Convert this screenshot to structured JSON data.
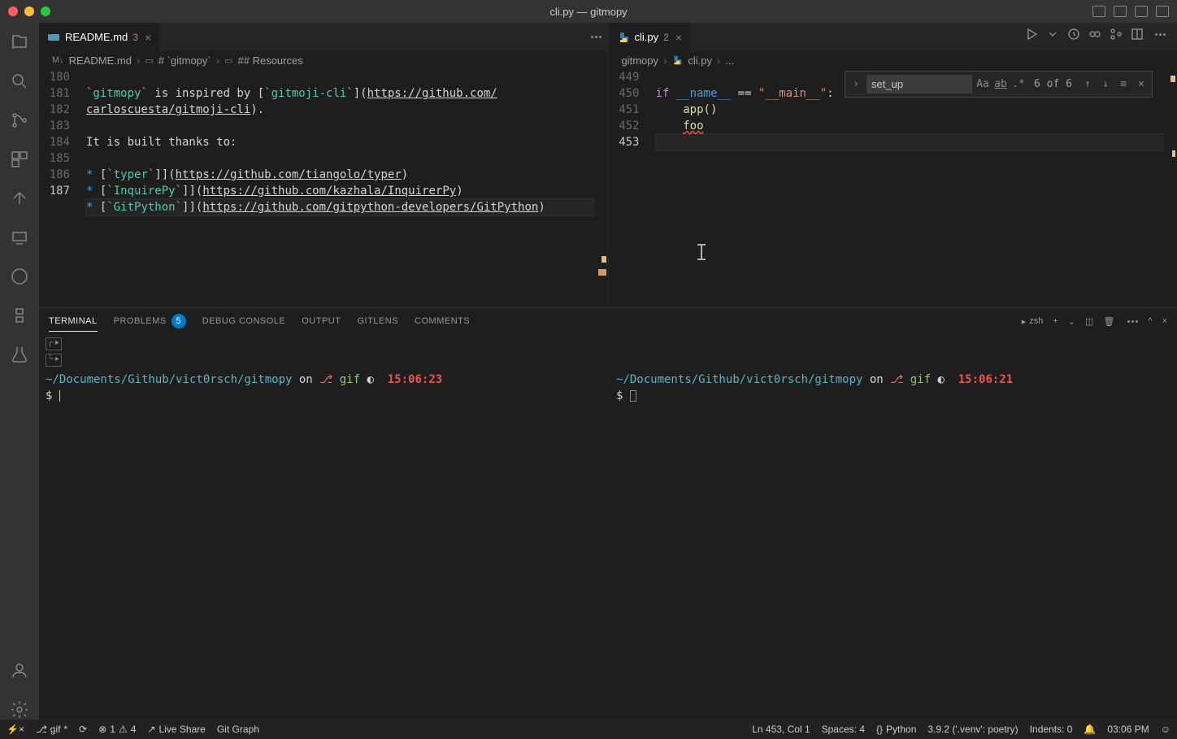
{
  "titlebar": {
    "title": "cli.py — gitmopy"
  },
  "tabs_left": {
    "name": "README.md",
    "badge": "3"
  },
  "tabs_right": {
    "name": "cli.py",
    "badge": "2"
  },
  "breadcrumb_left": [
    "README.md",
    "# `gitmopy`",
    "## Resources"
  ],
  "breadcrumb_right": [
    "gitmopy",
    "cli.py",
    "..."
  ],
  "find": {
    "value": "set_up",
    "count": "6 of 6"
  },
  "left_gutter": [
    "180",
    "181",
    "",
    "182",
    "183",
    "184",
    "185",
    "186",
    "187"
  ],
  "left_code": {
    "l181a": "`gitmopy`",
    "l181b": " is inspired by [",
    "l181c": "`gitmoji-cli`",
    "l181d": "](",
    "l181e": "https://github.com/",
    "l181f": "carloscuesta/gitmoji-cli",
    "l181g": ").",
    "l183": "It is built thanks to:",
    "l185a": "* [",
    "l185b": "`typer`",
    "l185c": "](",
    "l185d": "https://github.com/tiangolo/typer",
    "l185e": ")",
    "l186a": "* [",
    "l186b": "`InquirePy`",
    "l186c": "](",
    "l186d": "https://github.com/kazhala/InquirerPy",
    "l186e": ")",
    "l187a": "* [",
    "l187b": "`GitPython`",
    "l187c": "](",
    "l187d": "https://github.com/gitpython-developers/GitPython",
    "l187e": ")"
  },
  "right_gutter": [
    "449",
    "450",
    "451",
    "452",
    "453"
  ],
  "right_code": {
    "if": "if",
    "name": "__name__",
    "eq": " == ",
    "main": "\"__main__\"",
    "colon": ":",
    "app": "app",
    "paren": "()",
    "foo": "foo"
  },
  "panel_tabs": {
    "terminal": "TERMINAL",
    "problems": "PROBLEMS",
    "problems_count": "5",
    "debug": "DEBUG CONSOLE",
    "output": "OUTPUT",
    "gitlens": "GITLENS",
    "comments": "COMMENTS",
    "shell": "zsh"
  },
  "term1": {
    "path": "~/Documents/Github/vict0rsch/gitmopy",
    "on": " on ",
    "branch": "gif",
    "time": "15:06:23",
    "prompt": "$"
  },
  "term2": {
    "path": "~/Documents/Github/vict0rsch/gitmopy",
    "on": " on ",
    "branch": "gif",
    "time": "15:06:21",
    "prompt": "$"
  },
  "status": {
    "branch": "gif",
    "sync": "",
    "errors": "1",
    "warnings": "4",
    "live": "Live Share",
    "gitgraph": "Git Graph",
    "pos": "Ln 453, Col 1",
    "spaces": "Spaces: 4",
    "lang": "Python",
    "pyver": "3.9.2 ('.venv': poetry)",
    "indents": "Indents: 0",
    "clock": "03:06 PM"
  }
}
